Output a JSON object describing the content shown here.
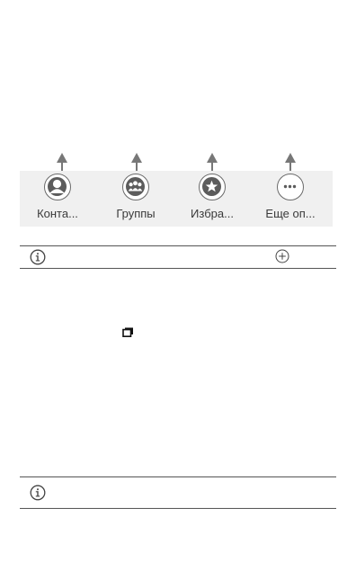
{
  "tabs": [
    {
      "label": "Конта...",
      "icon": "contact-person-icon"
    },
    {
      "label": "Группы",
      "icon": "group-people-icon"
    },
    {
      "label": "Избра...",
      "icon": "favorite-star-icon"
    },
    {
      "label": "Еще оп...",
      "icon": "more-options-icon"
    }
  ],
  "note_rows": [
    {
      "icons": [
        "info-icon",
        "add-circle-icon"
      ]
    },
    {
      "icons": [
        "info-icon"
      ]
    }
  ],
  "inline_icon": "recent-apps-icon",
  "colors": {
    "tabbar_background": "#f0f0f0",
    "icon_stroke": "#6a6a6a",
    "arrow": "#777777",
    "label_text": "#3a3a3a"
  }
}
